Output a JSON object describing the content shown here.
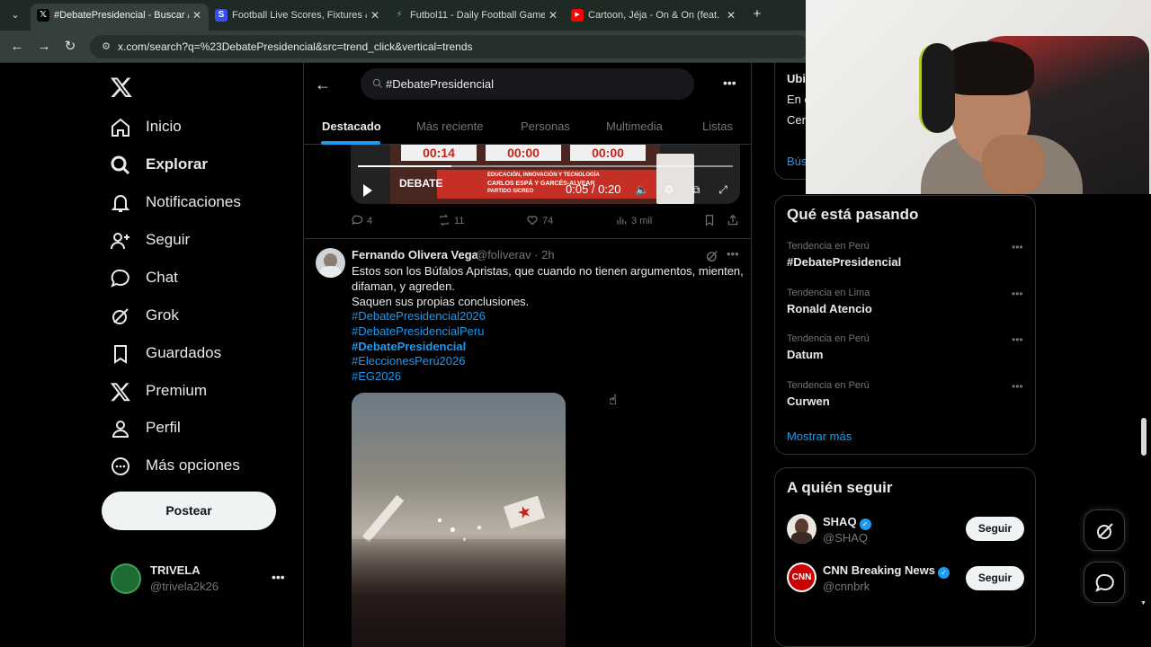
{
  "browser": {
    "tabs": [
      {
        "title": "#DebatePresidencial - Buscar /",
        "icon": "x-logo-icon",
        "active": true
      },
      {
        "title": "Football Live Scores, Fixtures &",
        "icon": "sofascore-icon",
        "active": false
      },
      {
        "title": "Futbol11 - Daily Football Game",
        "icon": "futbol11-icon",
        "active": false
      },
      {
        "title": "Cartoon, Jéja - On & On (feat. D",
        "icon": "youtube-icon",
        "active": false
      }
    ],
    "url": "x.com/search?q=%23DebatePresidencial&src=trend_click&vertical=trends"
  },
  "nav": {
    "items": [
      {
        "label": "Inicio",
        "icon": "home-icon"
      },
      {
        "label": "Explorar",
        "icon": "search-icon"
      },
      {
        "label": "Notificaciones",
        "icon": "bell-icon"
      },
      {
        "label": "Seguir",
        "icon": "follow-icon"
      },
      {
        "label": "Chat",
        "icon": "chat-icon"
      },
      {
        "label": "Grok",
        "icon": "grok-icon"
      },
      {
        "label": "Guardados",
        "icon": "bookmark-icon"
      },
      {
        "label": "Premium",
        "icon": "x-logo-icon"
      },
      {
        "label": "Perfil",
        "icon": "profile-icon"
      },
      {
        "label": "Más opciones",
        "icon": "more-circle-icon"
      }
    ],
    "post_label": "Postear",
    "account": {
      "name": "TRIVELA",
      "handle": "@trivela2k26"
    }
  },
  "search": {
    "query": "#DebatePresidencial",
    "tabs": [
      "Destacado",
      "Más reciente",
      "Personas",
      "Multimedia",
      "Listas"
    ],
    "active_tab": "Destacado"
  },
  "video_tweet": {
    "timers": [
      "00:14",
      "00:00",
      "00:00"
    ],
    "banner": {
      "brand": "DEBATE",
      "topic": "EDUCACIÓN, INNOVACIÓN Y TECNOLOGÍA",
      "candidate": "CARLOS ESPÁ Y GARCÉS-ALVEAR",
      "party": "PARTIDO SICREO"
    },
    "time": "0:05 / 0:20",
    "progress": 0.25,
    "stats": {
      "replies": "4",
      "reposts": "11",
      "likes": "74",
      "views": "3 mil"
    }
  },
  "post": {
    "author": "Fernando Olivera Vega",
    "handle_time": "@foliverav · 2h",
    "lines": [
      "Estos son los Búfalos Apristas, que cuando no tienen argumentos, mienten,",
      "difaman, y agreden.",
      "Saquen sus propias conclusiones."
    ],
    "hashtags": [
      "#DebatePresidencial2026",
      "#DebatePresidencialPeru",
      "#DebatePresidencial",
      "#EleccionesPerú2026",
      "#EG2026"
    ]
  },
  "right": {
    "location_box": {
      "title": "Ubi",
      "line1": "En c",
      "line2": "Cerc",
      "link": "Bús"
    },
    "trends": {
      "title": "Qué está pasando",
      "items": [
        {
          "meta": "Tendencia en Perú",
          "name": "#DebatePresidencial"
        },
        {
          "meta": "Tendencia en Lima",
          "name": "Ronald Atencio"
        },
        {
          "meta": "Tendencia en Perú",
          "name": "Datum"
        },
        {
          "meta": "Tendencia en Perú",
          "name": "Curwen"
        }
      ],
      "show_more": "Mostrar más"
    },
    "who_to_follow": {
      "title": "A quién seguir",
      "items": [
        {
          "name": "SHAQ",
          "handle": "@SHAQ",
          "button": "Seguir",
          "verified": true
        },
        {
          "name": "CNN Breaking News",
          "handle": "@cnnbrk",
          "button": "Seguir",
          "verified": true
        }
      ]
    }
  },
  "colors": {
    "accent": "#1d9bf0",
    "background": "#000000",
    "border": "#2f3336",
    "muted": "#71767b"
  }
}
